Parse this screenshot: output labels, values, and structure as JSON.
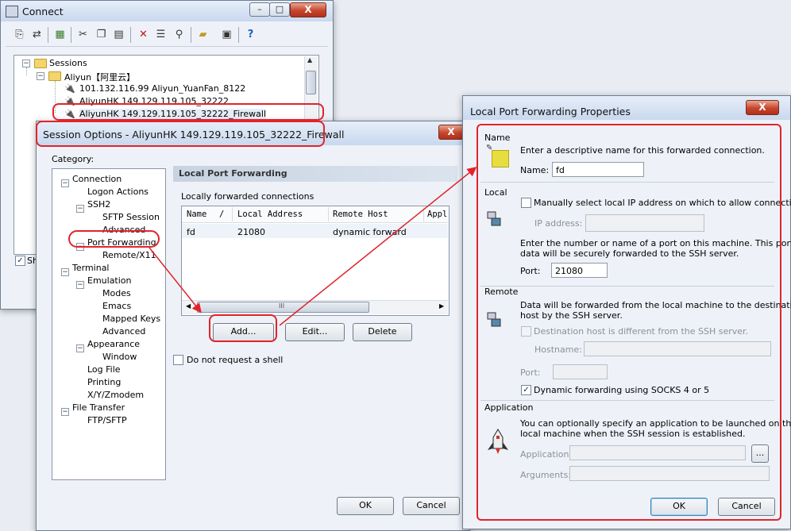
{
  "connect": {
    "title": "Connect",
    "caption_min": "–",
    "caption_max": "□",
    "caption_close": "X",
    "toolbar_icons": [
      "connect-icon",
      "quick-connect-icon",
      "new-folder-icon",
      "cut-icon",
      "copy-icon",
      "paste-icon",
      "delete-icon",
      "properties-icon",
      "find-icon",
      "open-folder-icon",
      "terminal-icon",
      "help-icon"
    ],
    "tree": {
      "sessions": "Sessions",
      "aliyun": "Aliyun【阿里云】",
      "items": [
        "101.132.116.99 Aliyun_YuanFan_8122",
        "AliyunHK 149.129.119.105_32222",
        "AliyunHK 149.129.119.105_32222_Firewall"
      ]
    },
    "show_label": "Sh"
  },
  "session_options": {
    "title": "Session Options - AliyunHK 149.129.119.105_32222_Firewall",
    "category_label": "Category:",
    "tree": [
      "Connection",
      "Logon Actions",
      "SSH2",
      "SFTP Session",
      "Advanced",
      "Port Forwarding",
      "Remote/X11",
      "Terminal",
      "Emulation",
      "Modes",
      "Emacs",
      "Mapped Keys",
      "Advanced",
      "Appearance",
      "Window",
      "Log File",
      "Printing",
      "X/Y/Zmodem",
      "File Transfer",
      "FTP/SFTP"
    ],
    "section_header": "Local Port Forwarding",
    "list_label": "Locally forwarded connections",
    "columns": [
      "Name",
      "/",
      "Local Address",
      "Remote Host",
      "Appl"
    ],
    "rows": [
      {
        "name": "fd",
        "local": "21080",
        "remote": "dynamic forward"
      }
    ],
    "add_button": "Add...",
    "edit_button": "Edit...",
    "delete_button": "Delete",
    "no_shell_label": "Do not request a shell",
    "ok": "OK",
    "cancel": "Cancel",
    "scroll_thumb": "III"
  },
  "lpf": {
    "title": "Local Port Forwarding Properties",
    "close": "X",
    "name_group": "Name",
    "name_desc": "Enter a descriptive name for this forwarded connection.",
    "name_label": "Name:",
    "name_value": "fd",
    "local_group": "Local",
    "manual_ip_label": "Manually select local IP address on which to allow connections.",
    "ip_label": "IP address:",
    "port_desc_1": "Enter the number or name of a port on this machine.  This port's",
    "port_desc_2": "data will be securely forwarded to the SSH server.",
    "port_label": "Port:",
    "port_value": "21080",
    "remote_group": "Remote",
    "remote_desc_1": "Data will be forwarded from the local machine to the destination",
    "remote_desc_2": "host by the SSH server.",
    "dest_diff_label": "Destination host is different from the SSH server.",
    "hostname_label": "Hostname:",
    "remote_port_label": "Port:",
    "dynamic_label": "Dynamic forwarding using SOCKS 4 or 5",
    "app_group": "Application",
    "app_desc_1": "You can optionally specify an application to be launched on the",
    "app_desc_2": "local machine when the SSH session is established.",
    "app_label": "Application:",
    "args_label": "Arguments:",
    "browse": "...",
    "ok": "OK",
    "cancel": "Cancel"
  },
  "annotation_color": "#e0242c"
}
